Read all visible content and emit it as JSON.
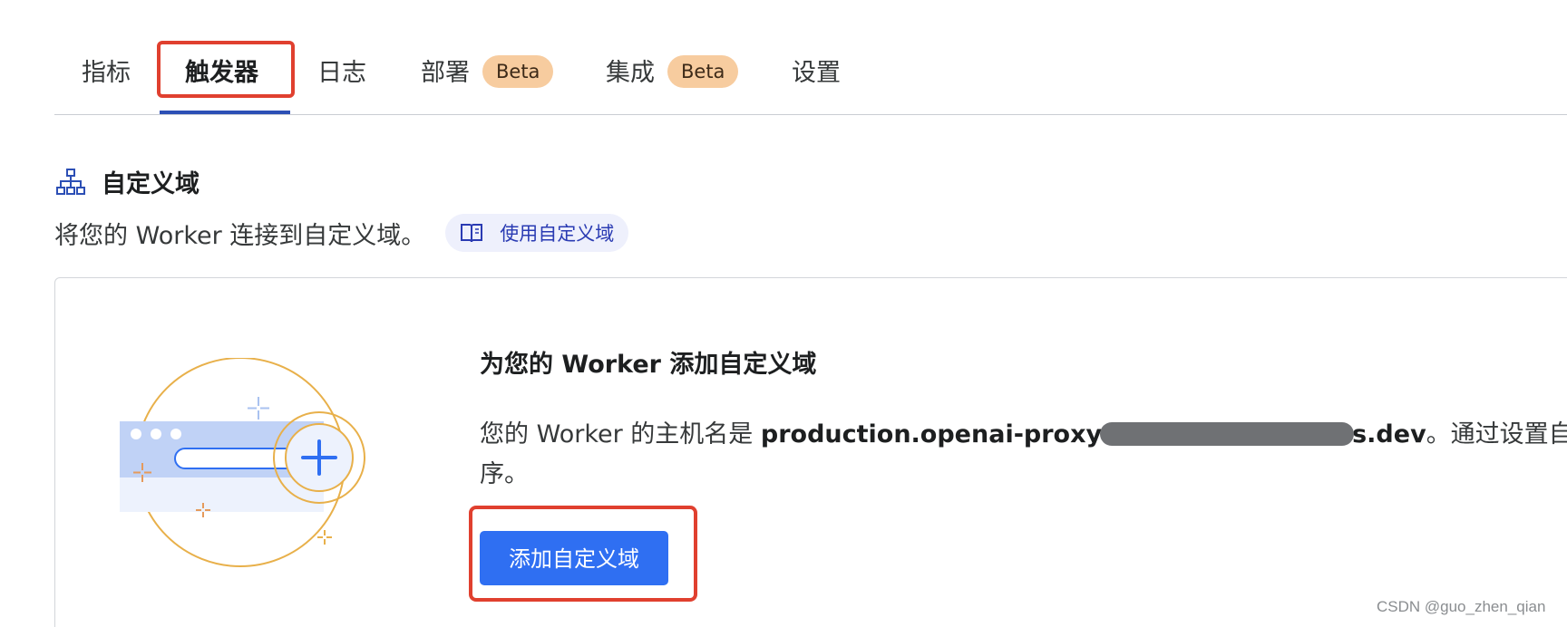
{
  "tabs": [
    {
      "label": "指标",
      "active": false
    },
    {
      "label": "触发器",
      "active": true
    },
    {
      "label": "日志",
      "active": false
    },
    {
      "label": "部署",
      "badge": "Beta",
      "active": false
    },
    {
      "label": "集成",
      "badge": "Beta",
      "active": false
    },
    {
      "label": "设置",
      "active": false
    }
  ],
  "section": {
    "icon": "sitemap-icon",
    "title": "自定义域",
    "description": "将您的 Worker 连接到自定义域。",
    "docs_link": {
      "icon": "book-icon",
      "label": "使用自定义域"
    }
  },
  "card": {
    "illustration": "browser-add-domain-illustration",
    "heading": "为您的 Worker 添加自定义域",
    "body_prefix": "您的 Worker 的主机名是 ",
    "hostname_start": "production.openai-proxy",
    "hostname_end": "s.dev",
    "body_suffix": "。通过设置自定",
    "body_line2": "序。",
    "button_label": "添加自定义域"
  },
  "colors": {
    "accent": "#2f6ff2",
    "badge_bg": "#f7cc9f",
    "highlight": "#e0402f",
    "tab_underline": "#2c4fb5"
  },
  "watermark": "CSDN @guo_zhen_qian"
}
